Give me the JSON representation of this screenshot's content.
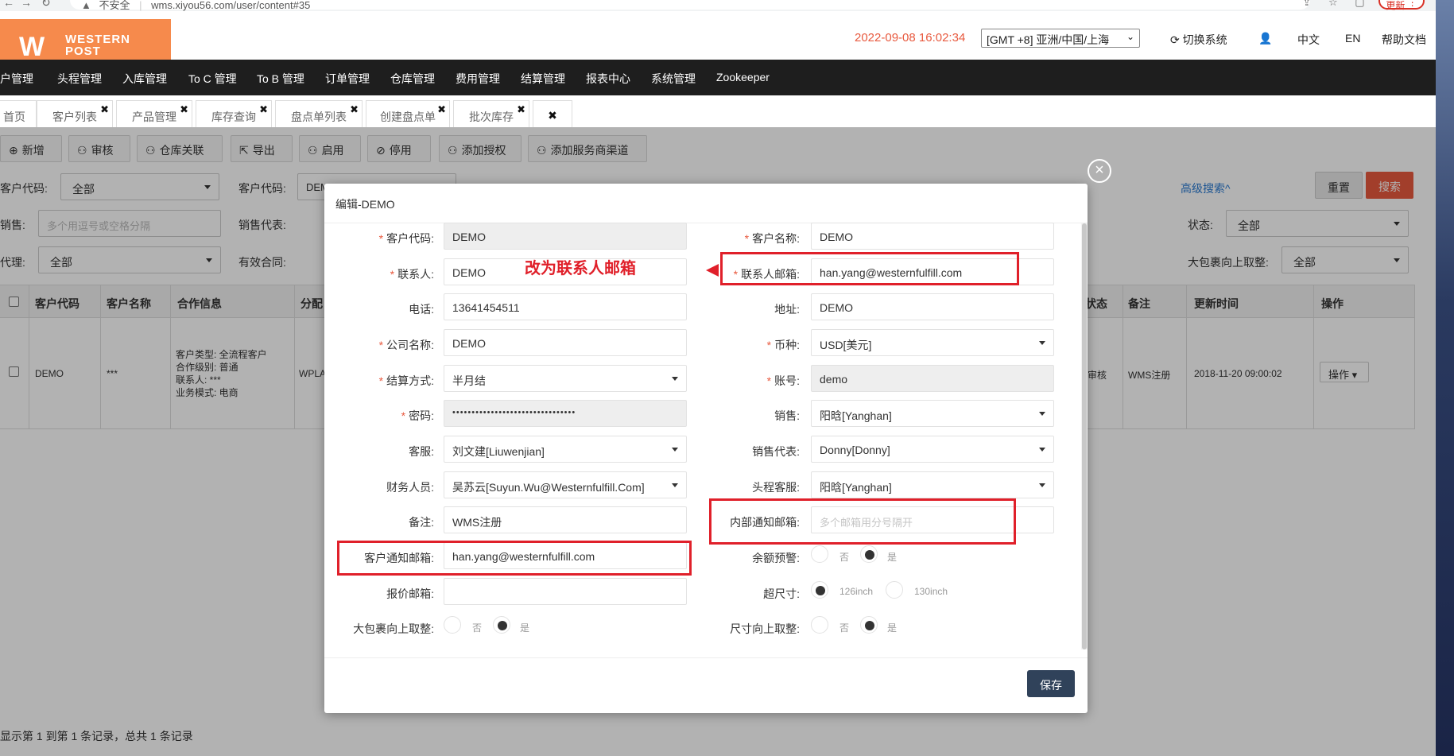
{
  "browser": {
    "insecure_label": "不安全",
    "url": "wms.xiyou56.com/user/content#35",
    "update_label": "更新"
  },
  "header": {
    "logo_line1": "WESTERN",
    "logo_line2": "POST",
    "datetime": "2022-09-08 16:02:34",
    "timezone": "[GMT +8] 亚洲/中国/上海",
    "switch_system": "切换系统",
    "lang_cn": "中文",
    "lang_en": "EN",
    "help": "帮助文档"
  },
  "menu": [
    "客户管理",
    "头程管理",
    "入库管理",
    "To C 管理",
    "To B 管理",
    "订单管理",
    "仓库管理",
    "费用管理",
    "结算管理",
    "报表中心",
    "系统管理",
    "Zookeeper"
  ],
  "tabs": [
    "首页",
    "客户列表",
    "产品管理",
    "库存查询",
    "盘点单列表",
    "创建盘点单",
    "批次库存"
  ],
  "toolbar": [
    "新增",
    "审核",
    "仓库关联",
    "导出",
    "启用",
    "停用",
    "添加授权",
    "添加服务商渠道"
  ],
  "filters": {
    "customer_code_label": "客户代码:",
    "customer_code_value": "全部",
    "customer_code2_label": "客户代码:",
    "customer_code2_value": "DEMO",
    "sales_label": "销售:",
    "sales_placeholder": "多个用逗号或空格分隔",
    "sales_rep_label": "销售代表:",
    "agent_label": "代理:",
    "agent_value": "全部",
    "contract_label": "有效合同:",
    "status_label": "状态:",
    "status_value": "全部",
    "round_label": "大包裹向上取整:",
    "round_value": "全部",
    "advanced": "高级搜索^",
    "reset": "重置",
    "search": "搜索"
  },
  "table": {
    "headers": [
      "客户代码",
      "客户名称",
      "合作信息",
      "分配",
      "状态",
      "备注",
      "更新时间",
      "操作"
    ],
    "row": {
      "code": "DEMO",
      "name": "***",
      "coop": [
        "客户类型: 全流程客户",
        "合作级别: 普通",
        "联系人: ***",
        "业务模式: 电商"
      ],
      "assign": "WPLA",
      "status": "审核",
      "remark": "WMS注册",
      "updated": "2018-11-20 09:00:02",
      "op": "操作"
    },
    "footer": "显示第 1 到第 1 条记录，总共 1 条记录"
  },
  "modal": {
    "title": "编辑-DEMO",
    "left": [
      {
        "label": "客户代码:",
        "value": "DEMO",
        "req": true,
        "style": "gray"
      },
      {
        "label": "联系人:",
        "value": "DEMO",
        "req": true,
        "style": "normal"
      },
      {
        "label": "电话:",
        "value": "13641454511",
        "req": false,
        "style": "normal"
      },
      {
        "label": "公司名称:",
        "value": "DEMO",
        "req": true,
        "style": "normal"
      },
      {
        "label": "结算方式:",
        "value": "半月结",
        "req": true,
        "style": "select"
      },
      {
        "label": "密码:",
        "value": "••••••••••••••••••••••••••••••••",
        "req": true,
        "style": "gray"
      },
      {
        "label": "客服:",
        "value": "刘文建[Liuwenjian]",
        "req": false,
        "style": "select"
      },
      {
        "label": "财务人员:",
        "value": "吴苏云[Suyun.Wu@Westernfulfill.Com]",
        "req": false,
        "style": "select"
      },
      {
        "label": "备注:",
        "value": "WMS注册",
        "req": false,
        "style": "normal"
      },
      {
        "label": "客户通知邮箱:",
        "value": "han.yang@westernfulfill.com",
        "req": false,
        "style": "normal"
      },
      {
        "label": "报价邮箱:",
        "value": "",
        "req": false,
        "style": "normal"
      }
    ],
    "right": [
      {
        "label": "客户名称:",
        "value": "DEMO",
        "req": true,
        "style": "normal"
      },
      {
        "label": "联系人邮箱:",
        "value": "han.yang@westernfulfill.com",
        "req": true,
        "style": "normal"
      },
      {
        "label": "地址:",
        "value": "DEMO",
        "req": false,
        "style": "normal"
      },
      {
        "label": "币种:",
        "value": "USD[美元]",
        "req": true,
        "style": "select"
      },
      {
        "label": "账号:",
        "value": "demo",
        "req": true,
        "style": "gray"
      },
      {
        "label": "销售:",
        "value": "阳晗[Yanghan]",
        "req": false,
        "style": "select"
      },
      {
        "label": "销售代表:",
        "value": "Donny[Donny]",
        "req": false,
        "style": "select"
      },
      {
        "label": "头程客服:",
        "value": "阳晗[Yanghan]",
        "req": false,
        "style": "select"
      },
      {
        "label": "内部通知邮箱:",
        "value": "多个邮箱用分号隔开",
        "req": false,
        "style": "placeholder"
      }
    ],
    "radio_rows": {
      "balance_warning": {
        "label": "余额预警:",
        "options": [
          "否",
          "是"
        ],
        "selected": 1
      },
      "oversize": {
        "label": "超尺寸:",
        "options": [
          "126inch",
          "130inch"
        ],
        "selected": 0
      },
      "big_round": {
        "label": "大包裹向上取整:",
        "options": [
          "否",
          "是"
        ],
        "selected": 1
      },
      "size_round": {
        "label": "尺寸向上取整:",
        "options": [
          "否",
          "是"
        ],
        "selected": 1
      }
    },
    "save": "保存",
    "close": "×"
  },
  "annotation": {
    "text": "改为联系人邮箱",
    "color": "#e0202a"
  },
  "colors": {
    "brand_orange": "#f68a4c",
    "accent_red": "#e8593e",
    "menu_dark": "#1e1e1e",
    "save_navy": "#30425a",
    "link_blue": "#2a7ad1"
  }
}
